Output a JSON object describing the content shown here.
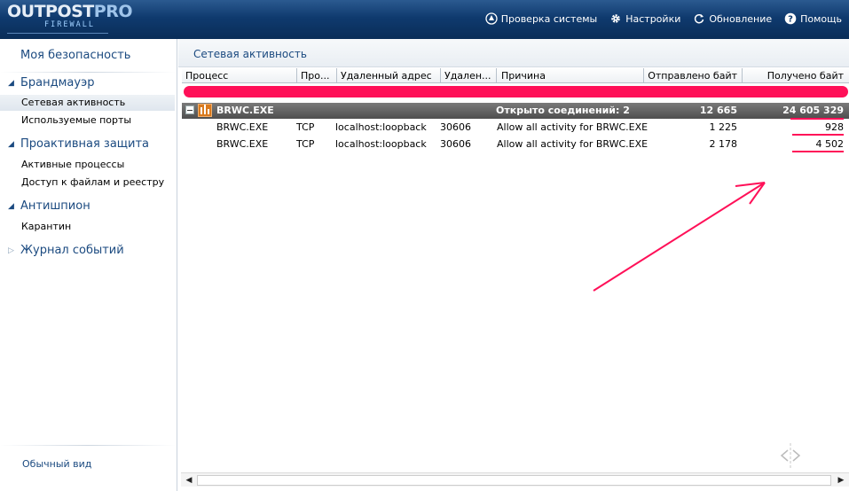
{
  "header": {
    "logo_main": "OUTPOST",
    "logo_pro": "PRO",
    "logo_sub": "FIREWALL",
    "menu": [
      {
        "label": "Проверка системы",
        "icon": "scan-icon"
      },
      {
        "label": "Настройки",
        "icon": "gear-icon"
      },
      {
        "label": "Обновление",
        "icon": "refresh-icon"
      },
      {
        "label": "Помощь",
        "icon": "help-icon"
      }
    ]
  },
  "sidebar": {
    "title": "Моя безопасность",
    "sections": [
      {
        "label": "Брандмауэр",
        "expanded": true,
        "items": [
          "Сетевая активность",
          "Используемые порты"
        ]
      },
      {
        "label": "Проактивная защита",
        "expanded": true,
        "items": [
          "Активные процессы",
          "Доступ к файлам и реестру"
        ]
      },
      {
        "label": "Антишпион",
        "expanded": true,
        "items": [
          "Карантин"
        ]
      },
      {
        "label": "Журнал событий",
        "expanded": false,
        "items": []
      }
    ],
    "view_mode": "Обычный вид"
  },
  "main": {
    "title": "Сетевая активность",
    "columns": [
      "Процесс",
      "Про...",
      "Удаленный адрес",
      "Удален...",
      "Причина",
      "Отправлено байт",
      "Получено байт"
    ],
    "group": {
      "process": "BRWC.EXE",
      "reason": "Открыто соединений: 2",
      "sent": "12 665",
      "received": "24 605 329"
    },
    "rows": [
      {
        "process": "BRWC.EXE",
        "protocol": "TCP",
        "remote_address": "localhost:loopback",
        "remote_port": "30606",
        "reason": "Allow all activity for BRWC.EXE",
        "sent": "1 225",
        "received": "928"
      },
      {
        "process": "BRWC.EXE",
        "protocol": "TCP",
        "remote_address": "localhost:loopback",
        "remote_port": "30606",
        "reason": "Allow all activity for BRWC.EXE",
        "sent": "2 178",
        "received": "4 502"
      }
    ]
  },
  "colors": {
    "header_bg": "#0f3a6e",
    "accent_blue": "#1b4a80",
    "annotation_red": "#ff1058"
  }
}
